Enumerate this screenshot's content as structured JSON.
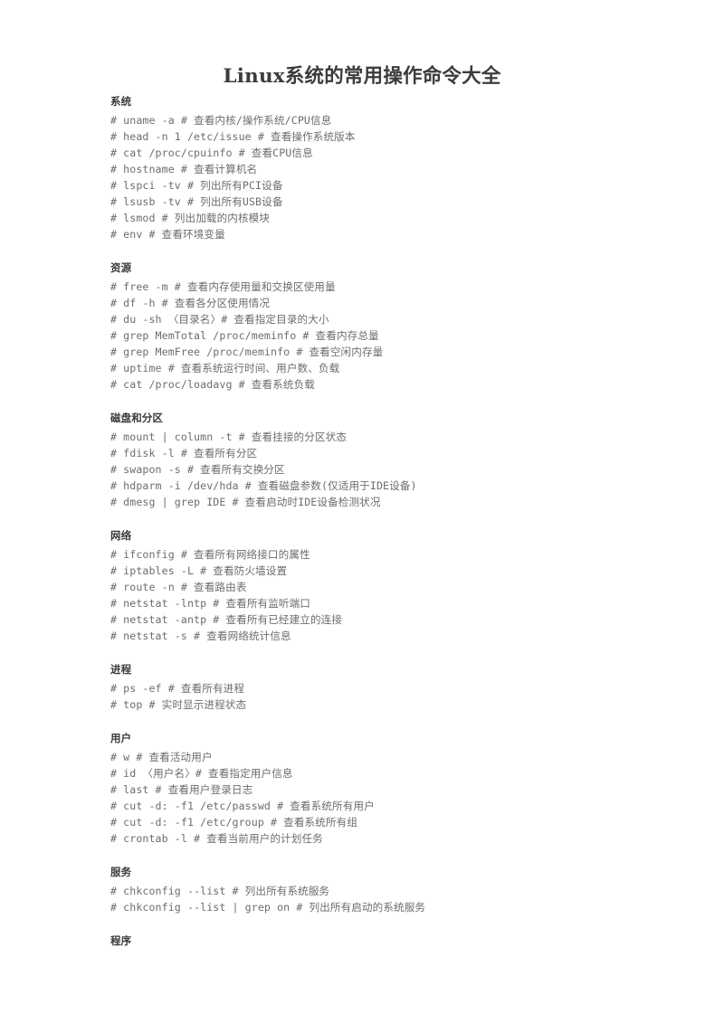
{
  "document": {
    "title": "Linux系统的常用操作命令大全"
  },
  "sections": [
    {
      "heading": "系统",
      "commands": [
        "# uname -a # 查看内核/操作系统/CPU信息",
        "# head -n 1 /etc/issue # 查看操作系统版本",
        "# cat /proc/cpuinfo # 查看CPU信息",
        "# hostname # 查看计算机名",
        "# lspci -tv # 列出所有PCI设备",
        "# lsusb -tv # 列出所有USB设备",
        "# lsmod # 列出加载的内核模块",
        "# env # 查看环境变量"
      ]
    },
    {
      "heading": "资源",
      "commands": [
        "# free -m # 查看内存使用量和交换区使用量",
        "# df -h # 查看各分区使用情况",
        "# du -sh 〈目录名〉# 查看指定目录的大小",
        "# grep MemTotal /proc/meminfo # 查看内存总量",
        "# grep MemFree /proc/meminfo # 查看空闲内存量",
        "# uptime # 查看系统运行时间、用户数、负载",
        "# cat /proc/loadavg # 查看系统负载"
      ]
    },
    {
      "heading": "磁盘和分区",
      "commands": [
        "# mount | column -t # 查看挂接的分区状态",
        "# fdisk -l # 查看所有分区",
        "# swapon -s # 查看所有交换分区",
        "# hdparm -i /dev/hda # 查看磁盘参数(仅适用于IDE设备)",
        "# dmesg | grep IDE # 查看启动时IDE设备检测状况"
      ]
    },
    {
      "heading": "网络",
      "commands": [
        "# ifconfig # 查看所有网络接口的属性",
        "# iptables -L # 查看防火墙设置",
        "# route -n # 查看路由表",
        "# netstat -lntp # 查看所有监听端口",
        "# netstat -antp # 查看所有已经建立的连接",
        "# netstat -s # 查看网络统计信息"
      ]
    },
    {
      "heading": "进程",
      "commands": [
        "# ps -ef # 查看所有进程",
        "# top # 实时显示进程状态"
      ]
    },
    {
      "heading": "用户",
      "commands": [
        "# w # 查看活动用户",
        "# id 〈用户名〉# 查看指定用户信息",
        "# last # 查看用户登录日志",
        "# cut -d: -f1 /etc/passwd # 查看系统所有用户",
        "# cut -d: -f1 /etc/group # 查看系统所有组",
        "# crontab -l # 查看当前用户的计划任务"
      ]
    },
    {
      "heading": "服务",
      "commands": [
        "# chkconfig --list # 列出所有系统服务",
        "# chkconfig --list | grep on # 列出所有启动的系统服务"
      ]
    },
    {
      "heading": "程序",
      "commands": []
    }
  ]
}
